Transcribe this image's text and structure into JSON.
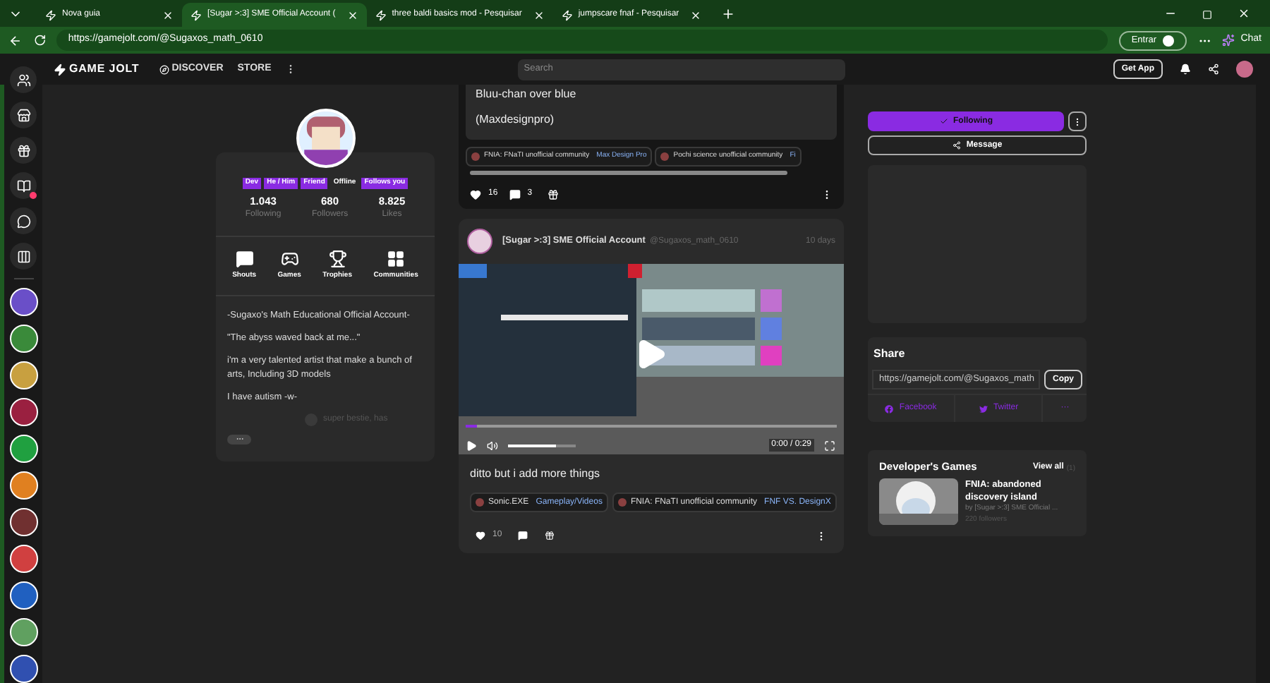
{
  "browser": {
    "tabs": [
      {
        "title": "Nova guia",
        "selected": false
      },
      {
        "title": "[Sugar >:3] SME Official Account (",
        "selected": true
      },
      {
        "title": "three baldi basics mod - Pesquisar",
        "selected": false
      },
      {
        "title": "jumpscare fnaf - Pesquisar",
        "selected": false
      }
    ],
    "url": "https://gamejolt.com/@Sugaxos_math_0610",
    "signin": "Entrar",
    "chat": "Chat"
  },
  "app_bar": {
    "logo": "GAME JOLT",
    "nav": [
      "DISCOVER",
      "STORE"
    ],
    "search": {
      "placeholder": "Search"
    },
    "get_app": "Get App"
  },
  "rail": {
    "items": [
      {
        "unread": false
      },
      {
        "unread": false
      },
      {
        "unread": false
      },
      {
        "unread": true
      },
      {
        "unread": false
      },
      {
        "unread": false
      }
    ],
    "communities": [
      {
        "color": "#6a4fc8"
      },
      {
        "color": "#3a8a3a"
      },
      {
        "color": "#c8a040"
      },
      {
        "color": "#9a2040"
      },
      {
        "color": "#20a040"
      },
      {
        "color": "#e08020"
      },
      {
        "color": "#703030"
      },
      {
        "color": "#d04040"
      },
      {
        "color": "#2060c0"
      },
      {
        "color": "#60a060"
      },
      {
        "color": "#3050b0"
      }
    ]
  },
  "profile": {
    "tags": [
      {
        "label": "Dev",
        "kind": "tag"
      },
      {
        "label": "He / Him",
        "kind": "tag"
      },
      {
        "label": "Friend",
        "kind": "tag"
      },
      {
        "label": "Offline",
        "kind": "status"
      },
      {
        "label": "Follows you",
        "kind": "tag"
      }
    ],
    "stats": [
      {
        "value": "1.043",
        "label": "Following"
      },
      {
        "value": "680",
        "label": "Followers"
      },
      {
        "value": "8.825",
        "label": "Likes"
      }
    ],
    "tabs": [
      {
        "label": "Shouts",
        "kind": "shouts"
      },
      {
        "label": "Games",
        "kind": "games"
      },
      {
        "label": "Trophies",
        "kind": "trophies"
      },
      {
        "label": "Communities",
        "kind": "communities"
      }
    ],
    "bio": [
      "-Sugaxo's Math Educational Official Account-",
      "\"The abyss waved back at me...\"",
      "i'm a very talented artist that make a bunch of arts, Including 3D models",
      "I have autism -w-"
    ],
    "link": "super bestie, has"
  },
  "posts": [
    {
      "lines": [
        "Bluu-chan over blue",
        "(Maxdesignpro)"
      ],
      "tags": [
        {
          "community": "FNIA: FNaTI unofficial community",
          "channel": "Max Design Pro"
        },
        {
          "community": "Pochi science unofficial community",
          "channel": "Fi"
        }
      ],
      "likes": "16",
      "comments": "3"
    },
    {
      "author": "[Sugar >:3] SME Official Account",
      "handle": "@Sugaxos_math_0610",
      "time": "10 days",
      "video": {
        "time": "0:00 / 0:29",
        "progress": {
          "level": 0.03
        },
        "volume": {
          "level": 0.7
        }
      },
      "text": "ditto but i add more things",
      "tags": [
        {
          "community": "Sonic.EXE",
          "channel": "Gameplay/Videos"
        },
        {
          "community": "FNIA: FNaTI unofficial community",
          "channel": "FNF VS. DesignX"
        }
      ],
      "likes": "10"
    }
  ],
  "side": {
    "follow": {
      "label": "Following",
      "following": true
    },
    "message": "Message",
    "share": {
      "title": "Share",
      "url": "https://gamejolt.com/@Sugaxos_math",
      "copy": "Copy",
      "links": [
        "Facebook",
        "Twitter",
        "···"
      ]
    },
    "games": {
      "title": "Developer's Games",
      "view_all": "View all",
      "count": "(1)",
      "items": [
        {
          "title": "FNIA: abandoned discovery island",
          "by": "by [Sugar >:3] SME Official ...",
          "followers": "220 followers"
        }
      ]
    }
  }
}
